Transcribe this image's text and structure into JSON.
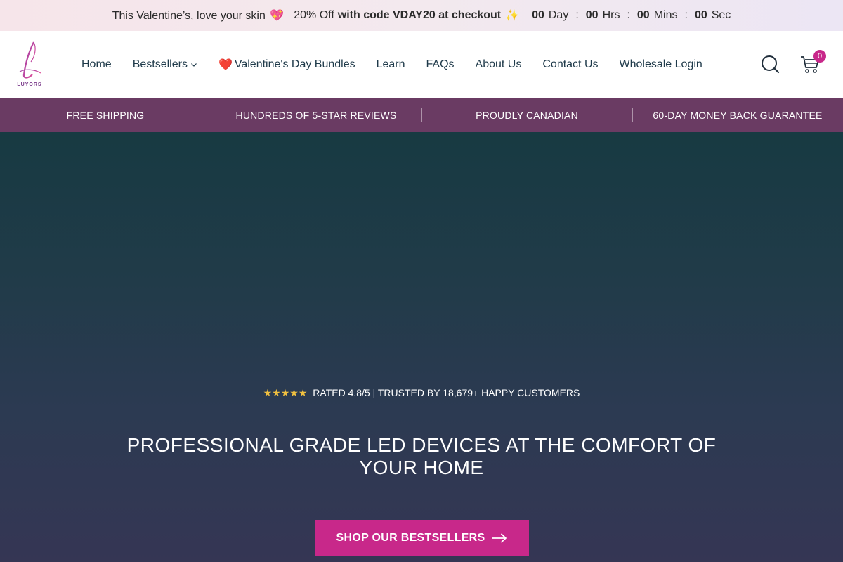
{
  "announcement": {
    "message": "This Valentine’s, love your skin",
    "heart": "💖",
    "discount": "20% Off",
    "code_text": "with code VDAY20 at checkout",
    "sparkle": "✨",
    "countdown": [
      {
        "value": "00",
        "unit": "Day"
      },
      {
        "value": "00",
        "unit": "Hrs"
      },
      {
        "value": "00",
        "unit": "Mins"
      },
      {
        "value": "00",
        "unit": "Sec"
      }
    ],
    "separator": ":"
  },
  "header": {
    "logo_text": "LUYORS",
    "nav": [
      {
        "label": "Home"
      },
      {
        "label": "Bestsellers",
        "has_dropdown": true
      },
      {
        "label": "Valentine's Day Bundles",
        "icon": "❤️"
      },
      {
        "label": "Learn"
      },
      {
        "label": "FAQs"
      },
      {
        "label": "About Us"
      },
      {
        "label": "Contact Us"
      },
      {
        "label": "Wholesale Login"
      }
    ],
    "cart_count": "0"
  },
  "benefits": [
    "FREE SHIPPING",
    "HUNDREDS OF 5-STAR REVIEWS",
    "PROUDLY CANADIAN",
    "60-DAY MONEY BACK GUARANTEE"
  ],
  "hero": {
    "stars": "★★★★★",
    "rating_text": "RATED 4.8/5 | TRUSTED BY 18,679+ HAPPY CUSTOMERS",
    "headline": "PROFESSIONAL GRADE LED DEVICES AT THE COMFORT OF YOUR HOME",
    "cta_label": "SHOP OUR BESTSELLERS"
  },
  "colors": {
    "accent": "#c8288a",
    "benefits_bar": "#6a3b63",
    "hero_top": "#173a42",
    "hero_bottom": "#353654"
  }
}
